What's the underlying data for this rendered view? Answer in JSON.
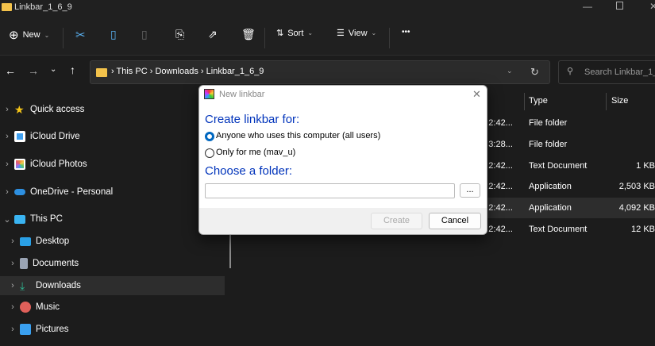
{
  "window": {
    "title": "Linkbar_1_6_9"
  },
  "toolbar": {
    "new": "New",
    "sort": "Sort",
    "view": "View",
    "more": "•••"
  },
  "address": {
    "crumbs": [
      "This PC",
      "Downloads",
      "Linkbar_1_6_9"
    ],
    "search_placeholder": "Search Linkbar_1_..."
  },
  "sidebar": {
    "items": [
      {
        "label": "Quick access",
        "icon": "star-icon",
        "color": "#f5c518"
      },
      {
        "label": "iCloud Drive",
        "icon": "icloud-drive-icon",
        "color": "#3fa0f0"
      },
      {
        "label": "iCloud Photos",
        "icon": "icloud-photos-icon",
        "color": "#e9863e"
      },
      {
        "label": "OneDrive - Personal",
        "icon": "onedrive-icon",
        "color": "#2d8fe0"
      },
      {
        "label": "This PC",
        "icon": "computer-icon",
        "color": "#3ab4f2"
      },
      {
        "label": "Desktop",
        "icon": "desktop-icon",
        "color": "#2aa0e6"
      },
      {
        "label": "Documents",
        "icon": "documents-icon",
        "color": "#9aa4b4"
      },
      {
        "label": "Downloads",
        "icon": "downloads-icon",
        "color": "#2fb893"
      },
      {
        "label": "Music",
        "icon": "music-icon",
        "color": "#e0605a"
      },
      {
        "label": "Pictures",
        "icon": "pictures-icon",
        "color": "#3aa0f0"
      }
    ]
  },
  "files": {
    "columns": {
      "type": "Type",
      "size": "Size"
    },
    "rows": [
      {
        "date": "21 2:42...",
        "type": "File folder",
        "size": ""
      },
      {
        "date": "21 3:28...",
        "type": "File folder",
        "size": ""
      },
      {
        "date": "21 2:42...",
        "type": "Text Document",
        "size": "1 KB"
      },
      {
        "date": "21 2:42...",
        "type": "Application",
        "size": "2,503 KB"
      },
      {
        "date": "21 2:42...",
        "type": "Application",
        "size": "4,092 KB"
      },
      {
        "date": "21 2:42...",
        "type": "Text Document",
        "size": "12 KB"
      }
    ]
  },
  "dialog": {
    "title": "New linkbar",
    "create_for": "Create linkbar for:",
    "option_all": "Anyone who uses this computer (all users)",
    "option_me": "Only for me (mav_u)",
    "choose_folder": "Choose a folder:",
    "folder_value": "",
    "browse": "...",
    "create": "Create",
    "cancel": "Cancel"
  }
}
